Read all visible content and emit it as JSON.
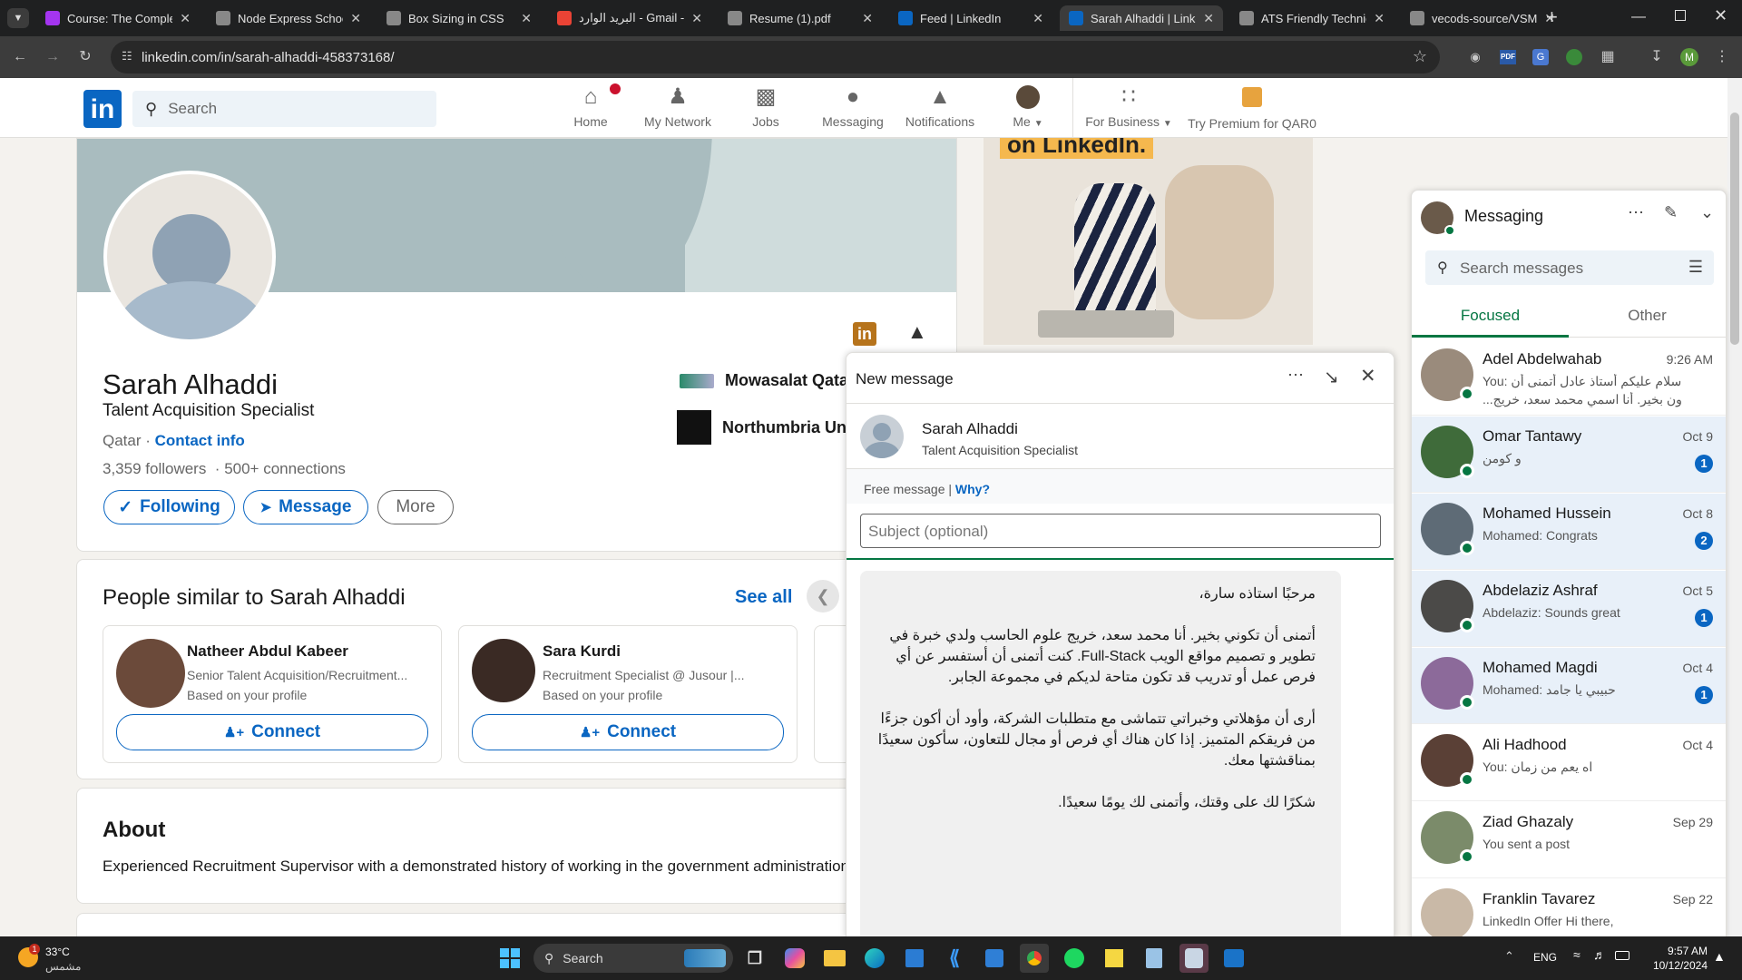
{
  "browser": {
    "tabs": [
      {
        "label": "Course: The Complete",
        "icon": "udemy-icon",
        "color": "#a435f0",
        "active": false
      },
      {
        "label": "Node Express School",
        "icon": "globe-icon",
        "color": "#888888",
        "active": false
      },
      {
        "label": "Box Sizing in CSS",
        "icon": "globe-icon",
        "color": "#888888",
        "active": false
      },
      {
        "label": "البريد الوارد - Gmail - m",
        "icon": "gmail-icon",
        "color": "#ea4335",
        "active": false
      },
      {
        "label": "Resume (1).pdf",
        "icon": "pdf-icon",
        "color": "#888888",
        "active": false
      },
      {
        "label": "Feed | LinkedIn",
        "icon": "linkedin-icon",
        "color": "#0a66c2",
        "active": false
      },
      {
        "label": "Sarah Alhaddi | Linke",
        "icon": "linkedin-icon",
        "color": "#0a66c2",
        "active": true
      },
      {
        "label": "ATS Friendly Technica",
        "icon": "google-icon",
        "color": "#888888",
        "active": false
      },
      {
        "label": "vecods-source/VSMS",
        "icon": "github-icon",
        "color": "#888888",
        "active": false
      }
    ],
    "url": "linkedin.com/in/sarah-alhaddi-458373168/",
    "profile_initial": "M"
  },
  "nav": {
    "search_placeholder": "Search",
    "items": [
      {
        "label": "Home",
        "icon": "home-icon"
      },
      {
        "label": "My Network",
        "icon": "network-icon"
      },
      {
        "label": "Jobs",
        "icon": "briefcase-icon"
      },
      {
        "label": "Messaging",
        "icon": "messaging-icon"
      },
      {
        "label": "Notifications",
        "icon": "bell-icon"
      },
      {
        "label": "Me",
        "icon": "avatar"
      },
      {
        "label": "For Business",
        "icon": "grid-icon"
      },
      {
        "label": "Try Premium for QAR0",
        "icon": "premium-icon"
      }
    ]
  },
  "profile": {
    "name": "Sarah Alhaddi",
    "headline": "Talent Acquisition Specialist",
    "location": "Qatar",
    "contact_info": "Contact info",
    "followers": "3,359 followers",
    "connections": "500+ connections",
    "following_label": "Following",
    "message_label": "Message",
    "more_label": "More",
    "experience_1": "Mowasalat Qatar",
    "experience_2": "Northumbria Univ"
  },
  "ad": {
    "text": "on LinkedIn."
  },
  "similar": {
    "title": "People similar to Sarah Alhaddi",
    "see_all": "See all",
    "people": [
      {
        "name": "Natheer Abdul Kabeer",
        "title": "Senior Talent Acquisition/Recruitment...",
        "note": "Based on your profile",
        "connect": "Connect"
      },
      {
        "name": "Sara Kurdi",
        "title": "Recruitment Specialist @ Jusour |...",
        "note": "Based on your profile",
        "connect": "Connect"
      }
    ]
  },
  "about": {
    "title": "About",
    "text": "Experienced Recruitment Supervisor with a demonstrated history of working in the government administration"
  },
  "messaging": {
    "title": "Messaging",
    "search_placeholder": "Search messages",
    "tab_focused": "Focused",
    "tab_other": "Other",
    "conversations": [
      {
        "name": "Adel Abdelwahab",
        "date": "9:26 AM",
        "preview": "You: سلام عليكم أستاذ عادل أتمنى أن",
        "preview2": "...ون بخير. أنا اسمي محمد سعد، خريج",
        "badge": "",
        "unread": false,
        "avatar_color": "#9a8b7c"
      },
      {
        "name": "Omar Tantawy",
        "date": "Oct 9",
        "preview": "و كومن",
        "preview2": "",
        "badge": "1",
        "unread": true,
        "avatar_color": "#3f6b3a"
      },
      {
        "name": "Mohamed Hussein",
        "date": "Oct 8",
        "preview": "Mohamed: Congrats",
        "preview2": "",
        "badge": "2",
        "unread": true,
        "avatar_color": "#5e6b76"
      },
      {
        "name": "Abdelaziz Ashraf",
        "date": "Oct 5",
        "preview": "Abdelaziz: Sounds great",
        "preview2": "",
        "badge": "1",
        "unread": true,
        "avatar_color": "#4b4a48"
      },
      {
        "name": "Mohamed Magdi",
        "date": "Oct 4",
        "preview": "Mohamed: حبيبي يا جامد",
        "preview2": "",
        "badge": "1",
        "unread": true,
        "avatar_color": "#8c6a9a"
      },
      {
        "name": "Ali Hadhood",
        "date": "Oct 4",
        "preview": "You: اه يعم من زمان",
        "preview2": "",
        "badge": "",
        "unread": false,
        "avatar_color": "#5a4036"
      },
      {
        "name": "Ziad Ghazaly",
        "date": "Sep 29",
        "preview": "You sent a post",
        "preview2": "",
        "badge": "",
        "unread": false,
        "avatar_color": "#7b8b6a"
      },
      {
        "name": "Franklin Tavarez",
        "date": "Sep 22",
        "preview": "LinkedIn Offer  Hi there,",
        "preview2": "",
        "badge": "",
        "unread": false,
        "avatar_color": "#c9b9a7"
      }
    ]
  },
  "new_message": {
    "title": "New message",
    "recipient_name": "Sarah Alhaddi",
    "recipient_title": "Talent Acquisition Specialist",
    "free_message": "Free message",
    "why": "Why?",
    "subject_placeholder": "Subject (optional)",
    "body_p1": "مرحبًا استاذه سارة،",
    "body_p2": "أتمنى أن تكوني بخير. أنا محمد سعد، خريج علوم الحاسب ولدي خبرة في تطوير و تصميم مواقع الويب Full-Stack. كنت أتمنى أن أستفسر عن أي فرص عمل أو تدريب قد تكون متاحة لديكم في مجموعة الجابر.",
    "body_p3": "أرى أن مؤهلاتي وخبراتي تتماشى مع متطلبات الشركة، وأود أن أكون جزءًا من فريقكم المتميز. إذا كان هناك أي فرص أو مجال للتعاون، سأكون سعيدًا بمناقشتها معك.",
    "body_p4": "شكرًا لك على وقتك، وأتمنى لك يومًا سعيدًا."
  },
  "taskbar": {
    "weather_temp": "33°C",
    "weather_desc": "مشمس",
    "weather_badge": "1",
    "search_label": "Search",
    "lang": "ENG",
    "time": "9:57 AM",
    "date": "10/12/2024"
  }
}
